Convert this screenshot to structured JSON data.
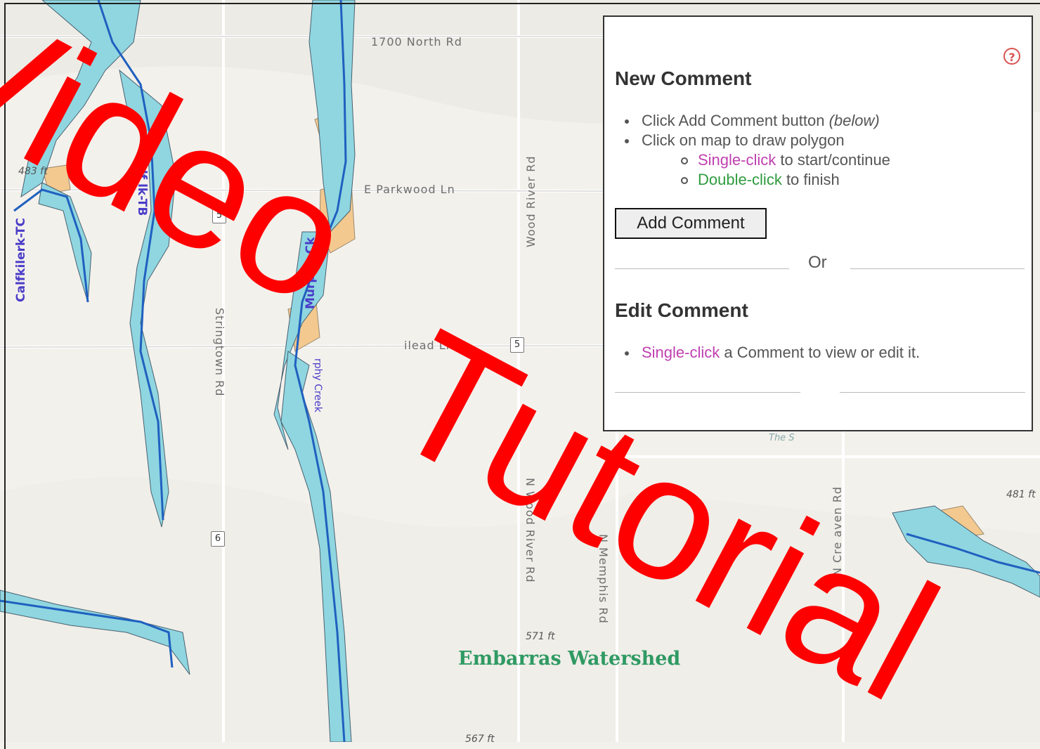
{
  "map": {
    "roads": {
      "north_1700": "1700 North Rd",
      "parkwood": "E Parkwood Ln",
      "wood_river": "Wood River Rd",
      "stringtown": "Stringtown Rd",
      "gilead": "ilead Ln",
      "n_wood_river": "N Wood River Rd",
      "n_memphis": "N Memphis Rd",
      "n_crev": "N Cre   aven Rd"
    },
    "elevations": {
      "e483": "483 ft",
      "e571": "571 ft",
      "e481": "481 ft",
      "e567": "567 ft"
    },
    "streams": {
      "calfkiller_tc": "Calfkilerk-TC",
      "calfkiller_tb": "Calf  lk-TB",
      "murphy_ck": "Murphy Ck",
      "murphy_creek": "rphy Creek"
    },
    "shields": {
      "s5a": "5",
      "s5b": "5",
      "s6": "6"
    },
    "watershed_label": "Embarras Watershed",
    "place_the": "The S",
    "colors": {
      "water": "#8fd6e0",
      "stream": "#2060c0",
      "wetland": "#f3c98f",
      "land": "#f3f1ec"
    }
  },
  "panel": {
    "help_icon_glyph": "?",
    "new_comment": {
      "title": "New Comment",
      "step1_text": "Click Add Comment button ",
      "step1_italic": "(below)",
      "step2_text": "Click on map to draw polygon",
      "sub1_action": "Single-click",
      "sub1_rest": " to start/continue",
      "sub2_action": "Double-click",
      "sub2_rest": " to finish"
    },
    "add_button": "Add Comment",
    "or_label": "Or",
    "edit_comment": {
      "title": "Edit Comment",
      "action": "Single-click",
      "rest": " a Comment to view or edit it."
    }
  },
  "watermark": {
    "word1": "Video",
    "word2": "Tutorial",
    "color": "#ff0000"
  }
}
